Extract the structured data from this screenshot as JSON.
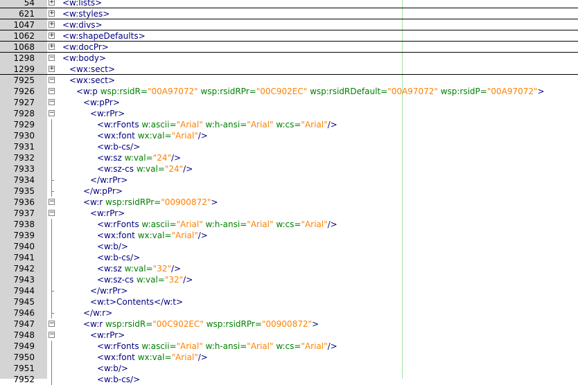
{
  "gutter": {
    "width_hint": "line numbers"
  },
  "lines": [
    {
      "n": "54",
      "fold": "plus",
      "indent": 0,
      "parts": [
        [
          "t",
          "<w:lists>"
        ]
      ],
      "sep": true
    },
    {
      "n": "621",
      "fold": "plus",
      "indent": 0,
      "parts": [
        [
          "t",
          "<w:styles>"
        ]
      ],
      "sep": true
    },
    {
      "n": "1047",
      "fold": "plus",
      "indent": 0,
      "parts": [
        [
          "t",
          "<w:divs>"
        ]
      ],
      "sep": true
    },
    {
      "n": "1062",
      "fold": "plus",
      "indent": 0,
      "parts": [
        [
          "t",
          "<w:shapeDefaults>"
        ]
      ],
      "sep": true
    },
    {
      "n": "1068",
      "fold": "plus",
      "indent": 0,
      "parts": [
        [
          "t",
          "<w:docPr>"
        ]
      ],
      "sep": true
    },
    {
      "n": "1298",
      "fold": "minus",
      "indent": 0,
      "parts": [
        [
          "t",
          "<w:body>"
        ]
      ]
    },
    {
      "n": "1299",
      "fold": "plus",
      "indent": 1,
      "parts": [
        [
          "t",
          "<wx:sect>"
        ]
      ],
      "sep": true
    },
    {
      "n": "7925",
      "fold": "minus",
      "indent": 1,
      "parts": [
        [
          "t",
          "<wx:sect>"
        ]
      ]
    },
    {
      "n": "7926",
      "fold": "minus",
      "indent": 2,
      "parts": [
        [
          "t",
          "<w:p "
        ],
        [
          "a",
          "wsp:rsidR="
        ],
        [
          "v",
          "\"00A97072\""
        ],
        [
          "a",
          " wsp:rsidRPr="
        ],
        [
          "v",
          "\"00C902EC\""
        ],
        [
          "a",
          " wsp:rsidRDefault="
        ],
        [
          "v",
          "\"00A97072\""
        ],
        [
          "a",
          " wsp:rsidP="
        ],
        [
          "v",
          "\"00A97072\""
        ],
        [
          "t",
          ">"
        ]
      ]
    },
    {
      "n": "7927",
      "fold": "minus",
      "indent": 3,
      "parts": [
        [
          "t",
          "<w:pPr>"
        ]
      ]
    },
    {
      "n": "7928",
      "fold": "minus",
      "indent": 4,
      "parts": [
        [
          "t",
          "<w:rPr>"
        ]
      ]
    },
    {
      "n": "7929",
      "fold": "tick",
      "indent": 5,
      "parts": [
        [
          "t",
          "<w:rFonts "
        ],
        [
          "a",
          "w:ascii="
        ],
        [
          "v",
          "\"Arial\""
        ],
        [
          "a",
          " w:h-ansi="
        ],
        [
          "v",
          "\"Arial\""
        ],
        [
          "a",
          " w:cs="
        ],
        [
          "v",
          "\"Arial\""
        ],
        [
          "t",
          "/>"
        ]
      ]
    },
    {
      "n": "7930",
      "fold": "tick",
      "indent": 5,
      "parts": [
        [
          "t",
          "<wx:font "
        ],
        [
          "a",
          "wx:val="
        ],
        [
          "v",
          "\"Arial\""
        ],
        [
          "t",
          "/>"
        ]
      ]
    },
    {
      "n": "7931",
      "fold": "tick",
      "indent": 5,
      "parts": [
        [
          "t",
          "<w:b-cs/>"
        ]
      ]
    },
    {
      "n": "7932",
      "fold": "tick",
      "indent": 5,
      "parts": [
        [
          "t",
          "<w:sz "
        ],
        [
          "a",
          "w:val="
        ],
        [
          "v",
          "\"24\""
        ],
        [
          "t",
          "/>"
        ]
      ]
    },
    {
      "n": "7933",
      "fold": "tick",
      "indent": 5,
      "parts": [
        [
          "t",
          "<w:sz-cs "
        ],
        [
          "a",
          "w:val="
        ],
        [
          "v",
          "\"24\""
        ],
        [
          "t",
          "/>"
        ]
      ]
    },
    {
      "n": "7934",
      "fold": "end",
      "indent": 4,
      "parts": [
        [
          "t",
          "</w:rPr>"
        ]
      ]
    },
    {
      "n": "7935",
      "fold": "end",
      "indent": 3,
      "parts": [
        [
          "t",
          "</w:pPr>"
        ]
      ]
    },
    {
      "n": "7936",
      "fold": "minus",
      "indent": 3,
      "parts": [
        [
          "t",
          "<w:r "
        ],
        [
          "a",
          "wsp:rsidRPr="
        ],
        [
          "v",
          "\"00900872\""
        ],
        [
          "t",
          ">"
        ]
      ]
    },
    {
      "n": "7937",
      "fold": "minus",
      "indent": 4,
      "parts": [
        [
          "t",
          "<w:rPr>"
        ]
      ]
    },
    {
      "n": "7938",
      "fold": "tick",
      "indent": 5,
      "parts": [
        [
          "t",
          "<w:rFonts "
        ],
        [
          "a",
          "w:ascii="
        ],
        [
          "v",
          "\"Arial\""
        ],
        [
          "a",
          " w:h-ansi="
        ],
        [
          "v",
          "\"Arial\""
        ],
        [
          "a",
          " w:cs="
        ],
        [
          "v",
          "\"Arial\""
        ],
        [
          "t",
          "/>"
        ]
      ]
    },
    {
      "n": "7939",
      "fold": "tick",
      "indent": 5,
      "parts": [
        [
          "t",
          "<wx:font "
        ],
        [
          "a",
          "wx:val="
        ],
        [
          "v",
          "\"Arial\""
        ],
        [
          "t",
          "/>"
        ]
      ]
    },
    {
      "n": "7940",
      "fold": "tick",
      "indent": 5,
      "parts": [
        [
          "t",
          "<w:b/>"
        ]
      ]
    },
    {
      "n": "7941",
      "fold": "tick",
      "indent": 5,
      "parts": [
        [
          "t",
          "<w:b-cs/>"
        ]
      ]
    },
    {
      "n": "7942",
      "fold": "tick",
      "indent": 5,
      "parts": [
        [
          "t",
          "<w:sz "
        ],
        [
          "a",
          "w:val="
        ],
        [
          "v",
          "\"32\""
        ],
        [
          "t",
          "/>"
        ]
      ]
    },
    {
      "n": "7943",
      "fold": "tick",
      "indent": 5,
      "parts": [
        [
          "t",
          "<w:sz-cs "
        ],
        [
          "a",
          "w:val="
        ],
        [
          "v",
          "\"32\""
        ],
        [
          "t",
          "/>"
        ]
      ]
    },
    {
      "n": "7944",
      "fold": "end",
      "indent": 4,
      "parts": [
        [
          "t",
          "</w:rPr>"
        ]
      ]
    },
    {
      "n": "7945",
      "fold": "tick",
      "indent": 4,
      "parts": [
        [
          "t",
          "<w:t>"
        ],
        [
          "x",
          "Contents"
        ],
        [
          "t",
          "</w:t>"
        ]
      ]
    },
    {
      "n": "7946",
      "fold": "end",
      "indent": 3,
      "parts": [
        [
          "t",
          "</w:r>"
        ]
      ]
    },
    {
      "n": "7947",
      "fold": "minus",
      "indent": 3,
      "parts": [
        [
          "t",
          "<w:r "
        ],
        [
          "a",
          "wsp:rsidR="
        ],
        [
          "v",
          "\"00C902EC\""
        ],
        [
          "a",
          " wsp:rsidRPr="
        ],
        [
          "v",
          "\"00900872\""
        ],
        [
          "t",
          ">"
        ]
      ]
    },
    {
      "n": "7948",
      "fold": "minus",
      "indent": 4,
      "parts": [
        [
          "t",
          "<w:rPr>"
        ]
      ]
    },
    {
      "n": "7949",
      "fold": "tick",
      "indent": 5,
      "parts": [
        [
          "t",
          "<w:rFonts "
        ],
        [
          "a",
          "w:ascii="
        ],
        [
          "v",
          "\"Arial\""
        ],
        [
          "a",
          " w:h-ansi="
        ],
        [
          "v",
          "\"Arial\""
        ],
        [
          "a",
          " w:cs="
        ],
        [
          "v",
          "\"Arial\""
        ],
        [
          "t",
          "/>"
        ]
      ]
    },
    {
      "n": "7950",
      "fold": "tick",
      "indent": 5,
      "parts": [
        [
          "t",
          "<wx:font "
        ],
        [
          "a",
          "wx:val="
        ],
        [
          "v",
          "\"Arial\""
        ],
        [
          "t",
          "/>"
        ]
      ]
    },
    {
      "n": "7951",
      "fold": "tick",
      "indent": 5,
      "parts": [
        [
          "t",
          "<w:b/>"
        ]
      ]
    },
    {
      "n": "7952",
      "fold": "tick",
      "indent": 5,
      "parts": [
        [
          "t",
          "<w:b-cs/>"
        ]
      ]
    }
  ]
}
